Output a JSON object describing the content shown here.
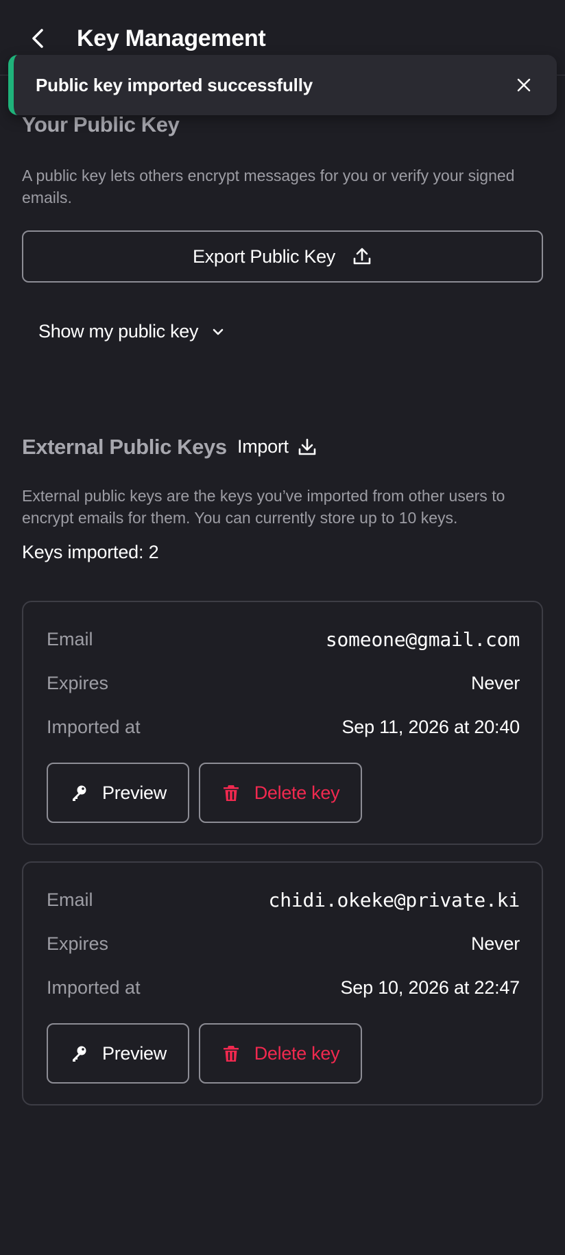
{
  "header": {
    "title": "Key Management",
    "back_icon": "chevron-left-icon"
  },
  "toast": {
    "message": "Public key imported successfully",
    "accent": "#1fb27a",
    "close_icon": "close-icon"
  },
  "your_key": {
    "title": "Your Public Key",
    "description": "A public key lets others encrypt messages for you or verify your signed emails.",
    "export_label": "Export Public Key",
    "export_icon": "upload-icon",
    "show_label": "Show my public key",
    "show_icon": "chevron-down-icon"
  },
  "external": {
    "title": "External Public Keys",
    "import_label": "Import",
    "import_icon": "download-icon",
    "description": "External public keys are the keys you’ve imported from other users to encrypt emails for them. You can currently store up to 10 keys.",
    "count_label": "Keys imported: 2",
    "field_labels": {
      "email": "Email",
      "expires": "Expires",
      "imported": "Imported at"
    },
    "preview_label": "Preview",
    "delete_label": "Delete key",
    "delete_color": "#f0294f",
    "keys": [
      {
        "email": "someone@gmail.com",
        "expires": "Never",
        "imported_at": "Sep 11, 2026 at 20:40"
      },
      {
        "email": "chidi.okeke@private.ki",
        "expires": "Never",
        "imported_at": "Sep 10, 2026 at 22:47"
      }
    ]
  }
}
